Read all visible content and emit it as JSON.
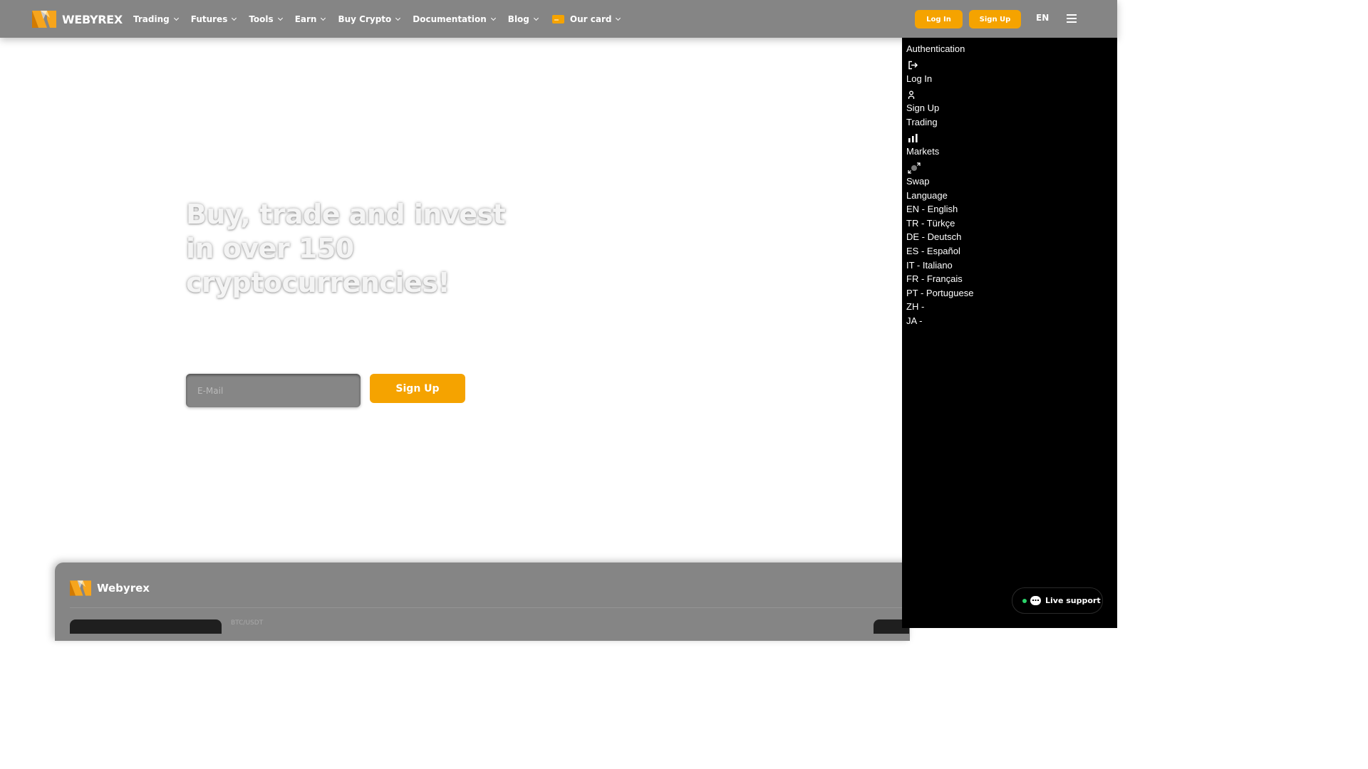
{
  "header": {
    "brand": "WEBYREX",
    "nav": [
      {
        "label": "Trading"
      },
      {
        "label": "Futures"
      },
      {
        "label": "Tools"
      },
      {
        "label": "Earn"
      },
      {
        "label": "Buy Crypto"
      },
      {
        "label": "Documentation"
      },
      {
        "label": "Blog"
      },
      {
        "label": "Our card"
      }
    ],
    "login_label": "Log In",
    "signup_label": "Sign Up",
    "language": "EN"
  },
  "hero": {
    "title": "Buy, trade and invest in over 150 cryptocurrencies!",
    "email_placeholder": "E-Mail",
    "signup_label": "Sign Up"
  },
  "widget": {
    "brand": "Webyrex",
    "pair": "BTC/USDT"
  },
  "drawer": {
    "auth_heading": "Authentication",
    "login": "Log In",
    "signup": "Sign Up",
    "trading_heading": "Trading",
    "markets": "Markets",
    "swap": "Swap",
    "language_heading": "Language",
    "languages": [
      "EN - English",
      "TR - Türkçe",
      "DE - Deutsch",
      "ES - Español",
      "IT - Italiano",
      "FR - Français",
      "PT - Portuguese",
      "ZH -",
      "JA -"
    ]
  },
  "live_support": {
    "label": "Live support"
  },
  "colors": {
    "accent": "#f5a300",
    "header_bg": "#858585",
    "drawer_bg": "#000000",
    "online": "#2bd46a"
  },
  "icons": [
    "logo-icon",
    "chevron-down-icon",
    "card-icon",
    "menu-icon",
    "login-icon",
    "user-icon",
    "bar-chart-icon",
    "swap-icon",
    "chat-icon"
  ]
}
